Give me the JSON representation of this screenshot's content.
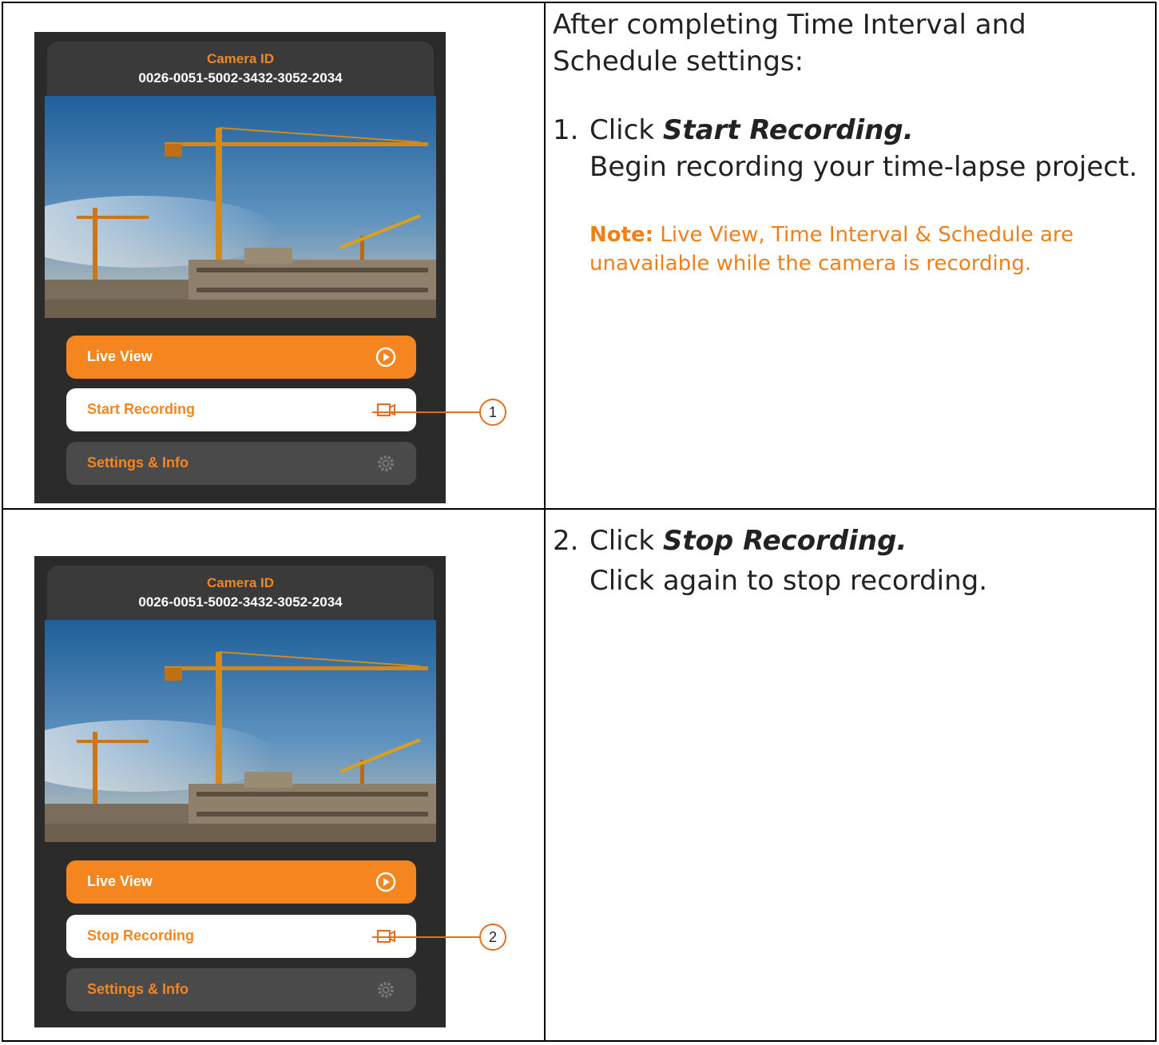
{
  "colors": {
    "accent": "#f5861f",
    "panel_bg": "#2b2b2b",
    "header_bg": "#3a3a3a",
    "settings_bg": "#4a4a4a",
    "callout": "#e27020"
  },
  "step1": {
    "intro": "After completing Time Interval and Schedule settings:",
    "number": "1.",
    "click_word": "Click",
    "action": "Start Recording.",
    "description": "Begin recording your time-lapse project.",
    "note_label": "Note:",
    "note_text": "Live View, Time Interval & Schedule are unavailable while the camera is recording.",
    "panel": {
      "camera_id_label": "Camera ID",
      "camera_id_value": "0026-0051-5002-3432-3052-2034",
      "live_view_label": "Live View",
      "record_label": "Start Recording",
      "settings_label": "Settings & Info",
      "callout": "1"
    }
  },
  "step2": {
    "number": "2.",
    "click_word": "Click",
    "action": "Stop Recording.",
    "description": "Click again to stop recording.",
    "panel": {
      "camera_id_label": "Camera ID",
      "camera_id_value": "0026-0051-5002-3432-3052-2034",
      "live_view_label": "Live View",
      "record_label": "Stop Recording",
      "settings_label": "Settings & Info",
      "callout": "2"
    }
  },
  "icons": {
    "live_view": "play-circle-icon",
    "record": "video-camera-icon",
    "settings": "gear-icon"
  }
}
